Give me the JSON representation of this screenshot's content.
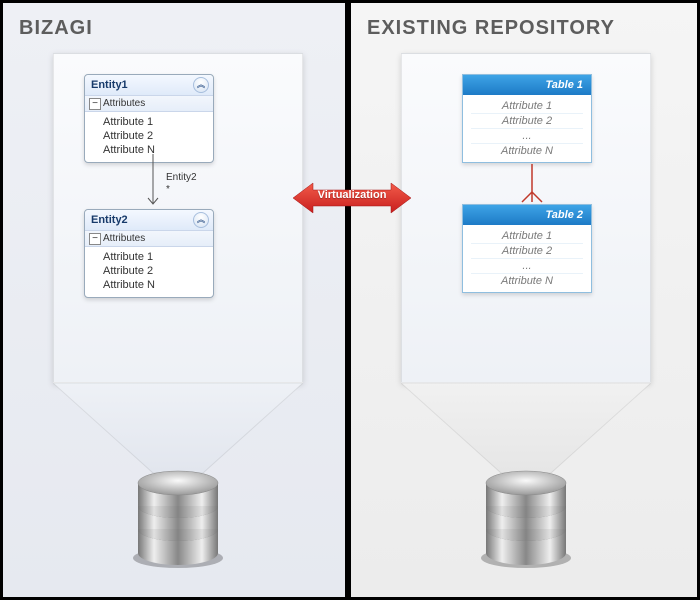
{
  "left": {
    "title": "BIZAGI",
    "entity1": {
      "name": "Entity1",
      "section": "Attributes",
      "attrs": [
        "Attribute 1",
        "Attribute 2",
        "Attribute N"
      ]
    },
    "entity2": {
      "name": "Entity2",
      "section": "Attributes",
      "attrs": [
        "Attribute 1",
        "Attribute 2",
        "Attribute N"
      ]
    },
    "relation": {
      "label": "Entity2",
      "mult": "*"
    }
  },
  "right": {
    "title": "EXISTING REPOSITORY",
    "table1": {
      "name": "Table 1",
      "attrs": [
        "Attribute 1",
        "Attribute 2",
        "...",
        "Attribute N"
      ]
    },
    "table2": {
      "name": "Table 2",
      "attrs": [
        "Attribute 1",
        "Attribute 2",
        "...",
        "Attribute N"
      ]
    }
  },
  "connector": {
    "label": "Virtualization"
  }
}
